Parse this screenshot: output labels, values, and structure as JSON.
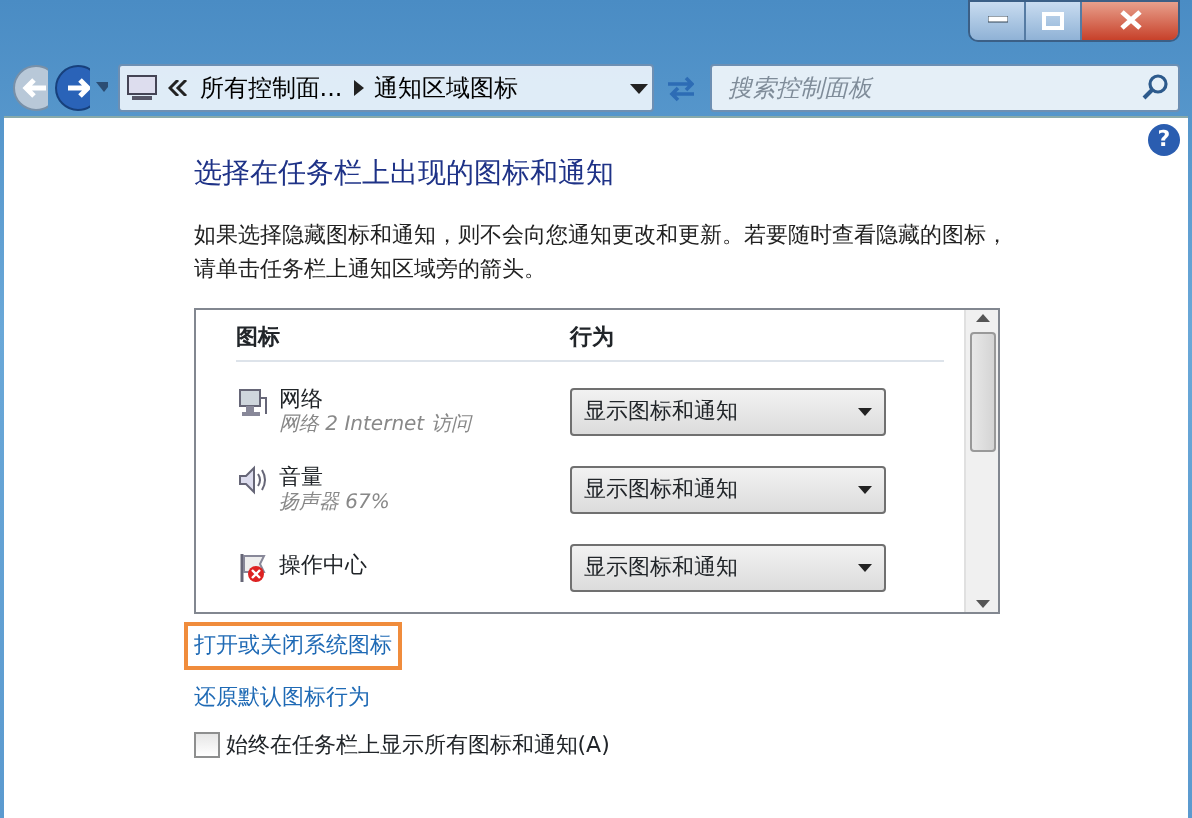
{
  "address": {
    "crumbs": [
      "所有控制面...",
      "通知区域图标"
    ]
  },
  "search": {
    "placeholder": "搜索控制面板"
  },
  "help": "?",
  "heading": "选择在任务栏上出现的图标和通知",
  "description": "如果选择隐藏图标和通知，则不会向您通知更改和更新。若要随时查看隐藏的图标，请单击任务栏上通知区域旁的箭头。",
  "table": {
    "columns": [
      "图标",
      "行为"
    ],
    "rows": [
      {
        "kind": "network",
        "name": "网络",
        "detail": "网络 2 Internet 访问",
        "behavior": "显示图标和通知"
      },
      {
        "kind": "volume",
        "name": "音量",
        "detail": "扬声器 67%",
        "behavior": "显示图标和通知"
      },
      {
        "kind": "action-center",
        "name": "操作中心",
        "behavior": "显示图标和通知"
      }
    ]
  },
  "links": [
    {
      "text": "打开或关闭系统图标",
      "focused": true
    },
    {
      "text": "还原默认图标行为",
      "focused": false
    }
  ],
  "always_show": {
    "label": "始终在任务栏上显示所有图标和通知(A)",
    "checked": false
  }
}
